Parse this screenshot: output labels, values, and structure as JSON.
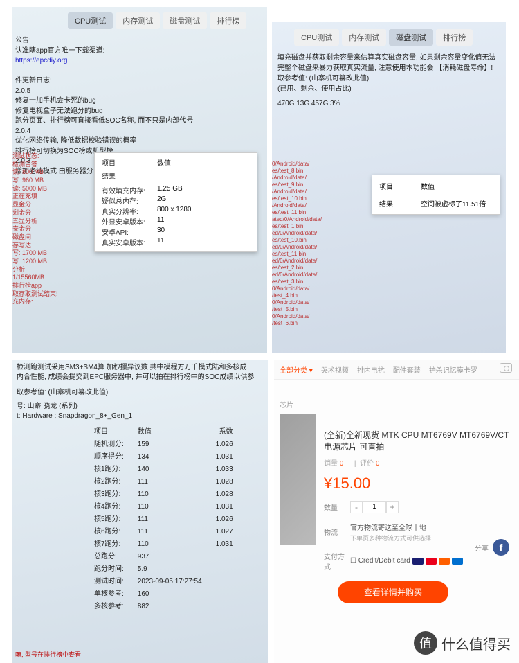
{
  "tabs": {
    "cpu": "CPU测试",
    "mem": "内存测试",
    "disk": "磁盘测试",
    "rank": "排行榜"
  },
  "q1": {
    "header1": "公告:",
    "header2": "认准瞎app官方唯一下载渠道:",
    "url": "https://epcdiy.org",
    "updateTitle": "件更新日志:",
    "v205": "2.0.5",
    "v205_item1": "修复一加手机会卡死的bug",
    "v205_item2": "修复电视盒子无法跑分的bug",
    "v205_item3": "跑分页面、排行榜可直接看低SOC名称, 而不只是内部代号",
    "v204": "2.0.4",
    "v204_item1": "优化网络传输, 降低数据校验错误的概率",
    "v204_item2": "排行榜可切换为SOC榜或机型榜",
    "v203": "2.0.3",
    "v203_item1": "增加老诗模式  由服务器分   神速判断失败则只",
    "popup": {
      "hdr_item": "项目",
      "hdr_val": "数值",
      "result_label": "结果",
      "r1k": "有效填充内存:",
      "r1v": "1.25 GB",
      "r2k": "疑似总内存:",
      "r2v": "2G",
      "r3k": "真实分辨率:",
      "r3v": "800 x 1280",
      "r4k": "外显安卓版本:",
      "r4v": "11",
      "r5k": "安卓API:",
      "r5v": "30",
      "r6k": "真实安卓版本:",
      "r6v": "11"
    },
    "leftcol": [
      "测试状态:",
      "检测告答",
      "读: 800 MB",
      "写: 960 MB",
      "读: 5000 MB",
      "正在充填",
      "显金分",
      "剩金分",
      "五显分析",
      "安金分",
      "磁盘间",
      "存写达",
      "写: 1700 MB",
      "写: 1200 MB",
      "分析",
      "1/15560MB",
      "排行榜app",
      "取存取测试结束!",
      "充内存:"
    ]
  },
  "q2": {
    "desc1": "填充磁盘并获取剩余容量来估算真实磁盘容量, 如果剩余容量变化值无法",
    "desc2": "完整个磁盘来暴力获取真实流量, 注意使用本功能会 【消耗磁盘寿命】!",
    "desc3": "取参考值:   (山寨机可篡改此值)",
    "desc4": "(已用、剩余、使用占比)",
    "values": "470G  13G  457G  3%",
    "popup": {
      "hdr_item": "项目",
      "hdr_val": "数值",
      "result_label": "结果",
      "result_value": "空间被虚标了11.51倍"
    },
    "files": [
      "0/Android/data/",
      "es/test_8.bin",
      "/Android/data/",
      "es/test_9.bin",
      "/Android/data/",
      "es/test_10.bin",
      "/Android/data/",
      "es/test_11.bin",
      "",
      "ated/0/Android/data/",
      "es/test_1.bin",
      "ed/0/Android/data/",
      "es/test_10.bin",
      "ed/0/Android/data/",
      "es/test_11.bin",
      "ed/0/Android/data/",
      "es/test_2.bin",
      "ed/0/Android/data/",
      "es/test_3.bin",
      "0/Android/data/",
      "/test_4.bin",
      "0/Android/data/",
      "/test_5.bin",
      "0/Android/data/",
      "/test_6.bin"
    ]
  },
  "q3": {
    "line1": "检测跑测试采用SM3+SM4算    加秒摆异议数   共中模程方万千模式陆和多核成",
    "line2": "内合性能, 成绩会提交到EPC服务器中, 并可以拍在排行榜中的SOC成绩以供参",
    "line3": "取参考值:   (山寨机可篡改此值)",
    "line4": "号: 山寨 骁龙  (系列)",
    "line5": "t: Hardware  : Snapdragon_8+_Gen_1",
    "th1": "项目",
    "th2": "数值",
    "th3": "系数",
    "rows": [
      {
        "k": "随机测分:",
        "v": "159",
        "c": "1.026"
      },
      {
        "k": "顺序得分:",
        "v": "134",
        "c": "1.031"
      },
      {
        "k": "核1跑分:",
        "v": "140",
        "c": "1.033"
      },
      {
        "k": "核2跑分:",
        "v": "111",
        "c": "1.028"
      },
      {
        "k": "核3跑分:",
        "v": "110",
        "c": "1.028"
      },
      {
        "k": "核4跑分:",
        "v": "110",
        "c": "1.031"
      },
      {
        "k": "核5跑分:",
        "v": "111",
        "c": "1.026"
      },
      {
        "k": "核6跑分:",
        "v": "111",
        "c": "1.027"
      },
      {
        "k": "核7跑分:",
        "v": "110",
        "c": "1.031"
      },
      {
        "k": "总跑分:",
        "v": "937",
        "c": ""
      },
      {
        "k": "跑分时间:",
        "v": "5.9",
        "c": ""
      },
      {
        "k": "测试时间:",
        "v": "2023-09-05 17:27:54",
        "c": ""
      },
      {
        "k": "单核参考:",
        "v": "160",
        "c": ""
      },
      {
        "k": "多核参考:",
        "v": "882",
        "c": ""
      }
    ],
    "footer": "嘛, 型号在排行榜中查看"
  },
  "q4": {
    "nav": [
      "全部分类 ▾",
      "哭术视频",
      "排内电抗",
      "配件套装",
      "护杀记忆膜卡罗"
    ],
    "catlabel": "芯片",
    "title": "(全新)全新现货 MTK CPU MT6769V MT6769V/CT 电源芯片 可直拍",
    "sales_label": "销量",
    "sales_val": "0",
    "reviews_label": "评价",
    "reviews_val": "0",
    "price": "¥15.00",
    "qty_label": "数量",
    "qty_value": "1",
    "ship_label": "物流",
    "ship_main": "官方物流寄送至全球十地",
    "ship_sub": "下单页多种物流方式可供选择",
    "pay_label": "支付方式",
    "pay_text": "Credit/Debit card",
    "buy_btn": "查看详情并购买",
    "share_label": "分享"
  },
  "watermark": "什么值得买"
}
